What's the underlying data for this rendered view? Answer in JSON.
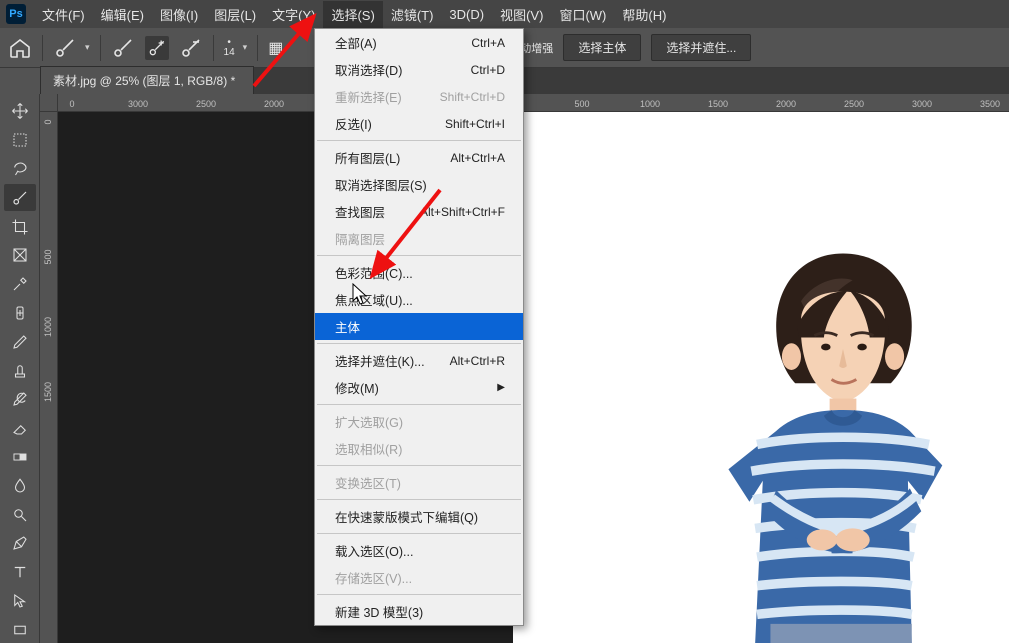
{
  "app": {
    "ps_label": "Ps"
  },
  "menubar": {
    "items": [
      {
        "label": "文件(F)"
      },
      {
        "label": "编辑(E)"
      },
      {
        "label": "图像(I)"
      },
      {
        "label": "图层(L)"
      },
      {
        "label": "文字(Y)"
      },
      {
        "label": "选择(S)"
      },
      {
        "label": "滤镜(T)"
      },
      {
        "label": "3D(D)"
      },
      {
        "label": "视图(V)"
      },
      {
        "label": "窗口(W)"
      },
      {
        "label": "帮助(H)"
      }
    ]
  },
  "optionsbar": {
    "size_num": "14",
    "auto_enhance": "自动增强",
    "select_subject_btn": "选择主体",
    "select_and_mask_btn": "选择并遮住..."
  },
  "tab": {
    "title": "素材.jpg @ 25% (图层 1, RGB/8) *"
  },
  "ruler": {
    "h": [
      "0",
      "3000",
      "2500",
      "2000",
      "500",
      "1000",
      "1500",
      "2000",
      "2500",
      "3000",
      "3500"
    ],
    "v": [
      "0",
      "500",
      "1000",
      "1500"
    ]
  },
  "dropdown": {
    "items": [
      {
        "label": "全部(A)",
        "shortcut": "Ctrl+A"
      },
      {
        "label": "取消选择(D)",
        "shortcut": "Ctrl+D"
      },
      {
        "label": "重新选择(E)",
        "shortcut": "Shift+Ctrl+D",
        "disabled": true
      },
      {
        "label": "反选(I)",
        "shortcut": "Shift+Ctrl+I"
      },
      {
        "sep": true
      },
      {
        "label": "所有图层(L)",
        "shortcut": "Alt+Ctrl+A"
      },
      {
        "label": "取消选择图层(S)"
      },
      {
        "label": "查找图层",
        "shortcut": "Alt+Shift+Ctrl+F"
      },
      {
        "label": "隔离图层",
        "disabled": true
      },
      {
        "sep": true
      },
      {
        "label": "色彩范围(C)..."
      },
      {
        "label": "焦点区域(U)..."
      },
      {
        "label": "主体",
        "highlight": true
      },
      {
        "sep": true
      },
      {
        "label": "选择并遮住(K)...",
        "shortcut": "Alt+Ctrl+R"
      },
      {
        "label": "修改(M)",
        "submenu": true
      },
      {
        "sep": true
      },
      {
        "label": "扩大选取(G)",
        "disabled": true
      },
      {
        "label": "选取相似(R)",
        "disabled": true
      },
      {
        "sep": true
      },
      {
        "label": "变换选区(T)",
        "disabled": true
      },
      {
        "sep": true
      },
      {
        "label": "在快速蒙版模式下编辑(Q)"
      },
      {
        "sep": true
      },
      {
        "label": "载入选区(O)..."
      },
      {
        "label": "存储选区(V)...",
        "disabled": true
      },
      {
        "sep": true
      },
      {
        "label": "新建 3D 模型(3)"
      }
    ]
  }
}
